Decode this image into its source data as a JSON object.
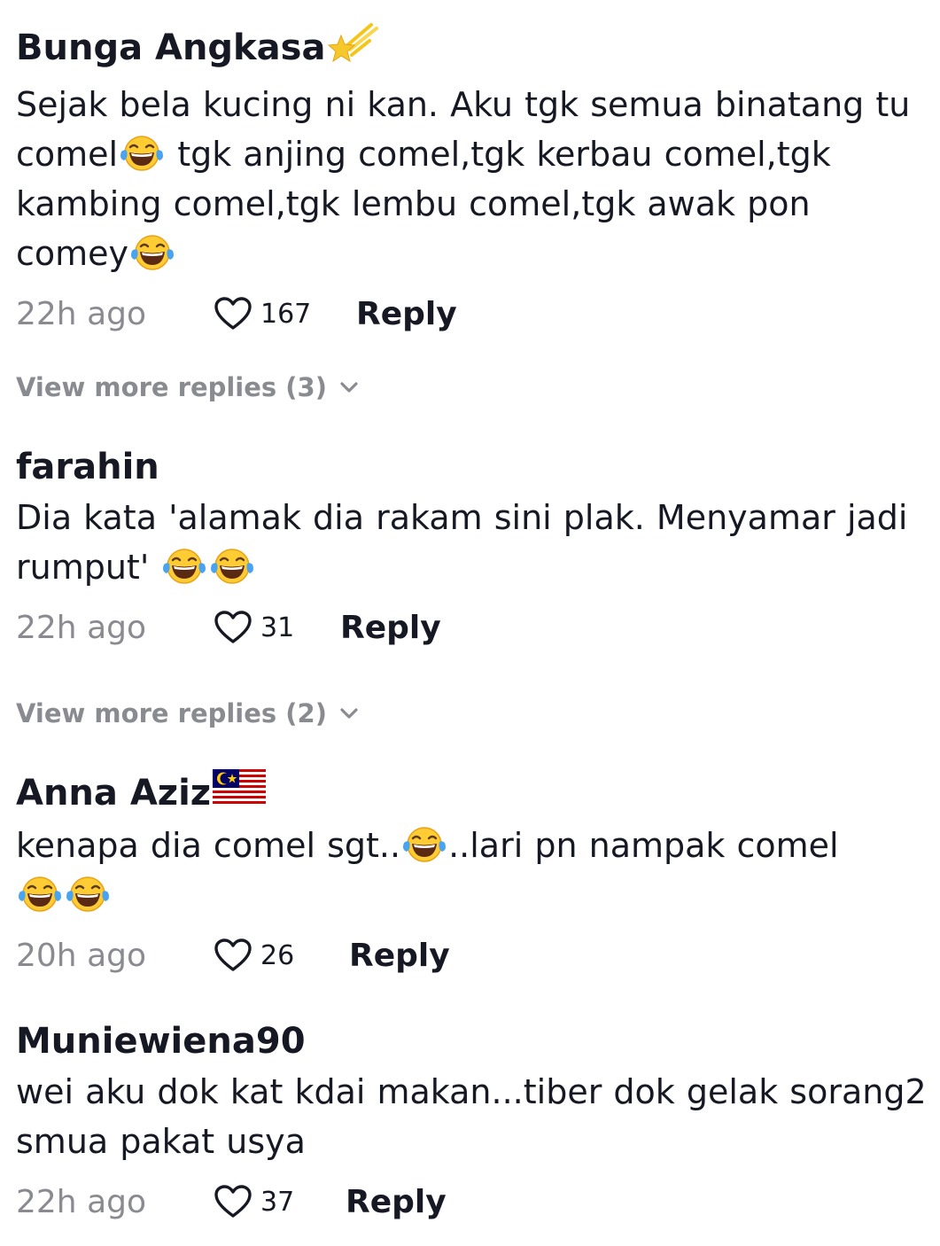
{
  "comments": [
    {
      "username": "Bunga Angkasa",
      "badge_icon": "shooting-star-icon",
      "text_parts": [
        "Sejak bela kucing ni kan. Aku tgk semua binatang tu comel",
        " tgk anjing comel,tgk kerbau comel,tgk kambing comel,tgk lembu comel,tgk awak pon comey"
      ],
      "emoji_icon": "face-with-tears-of-joy-icon",
      "time": "22h ago",
      "likes": "167",
      "reply_label": "Reply"
    },
    {
      "username": "farahin",
      "text_parts": [
        "Dia kata 'alamak dia rakam sini plak. Menyamar jadi rumput' "
      ],
      "emoji_icon": "face-with-tears-of-joy-icon",
      "time": "22h ago",
      "likes": "31",
      "reply_label": "Reply"
    },
    {
      "username": "Anna Aziz",
      "badge_icon": "malaysia-flag-icon",
      "text_parts": [
        "kenapa dia comel sgt..",
        "..lari pn nampak comel"
      ],
      "emoji_icon": "face-with-tears-of-joy-icon",
      "time": "20h ago",
      "likes": "26",
      "reply_label": "Reply"
    },
    {
      "username": "Muniewiena90",
      "text_parts": [
        "wei aku dok kat kdai makan...tiber dok gelak sorang2 smua pakat usya"
      ],
      "time": "22h ago",
      "likes": "37",
      "reply_label": "Reply"
    }
  ],
  "view_more": [
    {
      "label": "View more replies (3)"
    },
    {
      "label": "View more replies (2)"
    }
  ],
  "colors": {
    "text": "#161823",
    "muted": "#8a8b91",
    "background": "#ffffff"
  }
}
